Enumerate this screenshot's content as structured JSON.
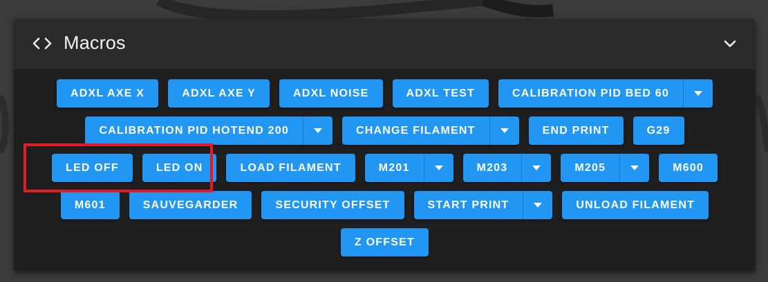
{
  "panel": {
    "title": "Macros",
    "icons": {
      "title_icon": "code-icon",
      "collapse_icon": "chevron-down-icon"
    }
  },
  "colors": {
    "button_bg": "#2196f3",
    "panel_bg": "#1f1f1f",
    "header_bg": "#2a2a2a",
    "highlight": "#e31c23"
  },
  "rows": [
    [
      {
        "label": "ADXL AXE X",
        "dropdown": false
      },
      {
        "label": "ADXL AXE Y",
        "dropdown": false
      },
      {
        "label": "ADXL NOISE",
        "dropdown": false
      },
      {
        "label": "ADXL TEST",
        "dropdown": false
      },
      {
        "label": "CALIBRATION PID BED 60",
        "dropdown": true
      }
    ],
    [
      {
        "label": "CALIBRATION PID HOTEND 200",
        "dropdown": true
      },
      {
        "label": "CHANGE FILAMENT",
        "dropdown": true
      },
      {
        "label": "END PRINT",
        "dropdown": false
      },
      {
        "label": "G29",
        "dropdown": false
      }
    ],
    [
      {
        "label": "LED OFF",
        "dropdown": false
      },
      {
        "label": "LED ON",
        "dropdown": false
      },
      {
        "label": "LOAD FILAMENT",
        "dropdown": false
      },
      {
        "label": "M201",
        "dropdown": true
      },
      {
        "label": "M203",
        "dropdown": true
      },
      {
        "label": "M205",
        "dropdown": true
      },
      {
        "label": "M600",
        "dropdown": false
      }
    ],
    [
      {
        "label": "M601",
        "dropdown": false
      },
      {
        "label": "SAUVEGARDER",
        "dropdown": false
      },
      {
        "label": "SECURITY OFFSET",
        "dropdown": false
      },
      {
        "label": "START PRINT",
        "dropdown": true
      },
      {
        "label": "UNLOAD FILAMENT",
        "dropdown": false
      }
    ],
    [
      {
        "label": "Z OFFSET",
        "dropdown": false
      }
    ]
  ]
}
